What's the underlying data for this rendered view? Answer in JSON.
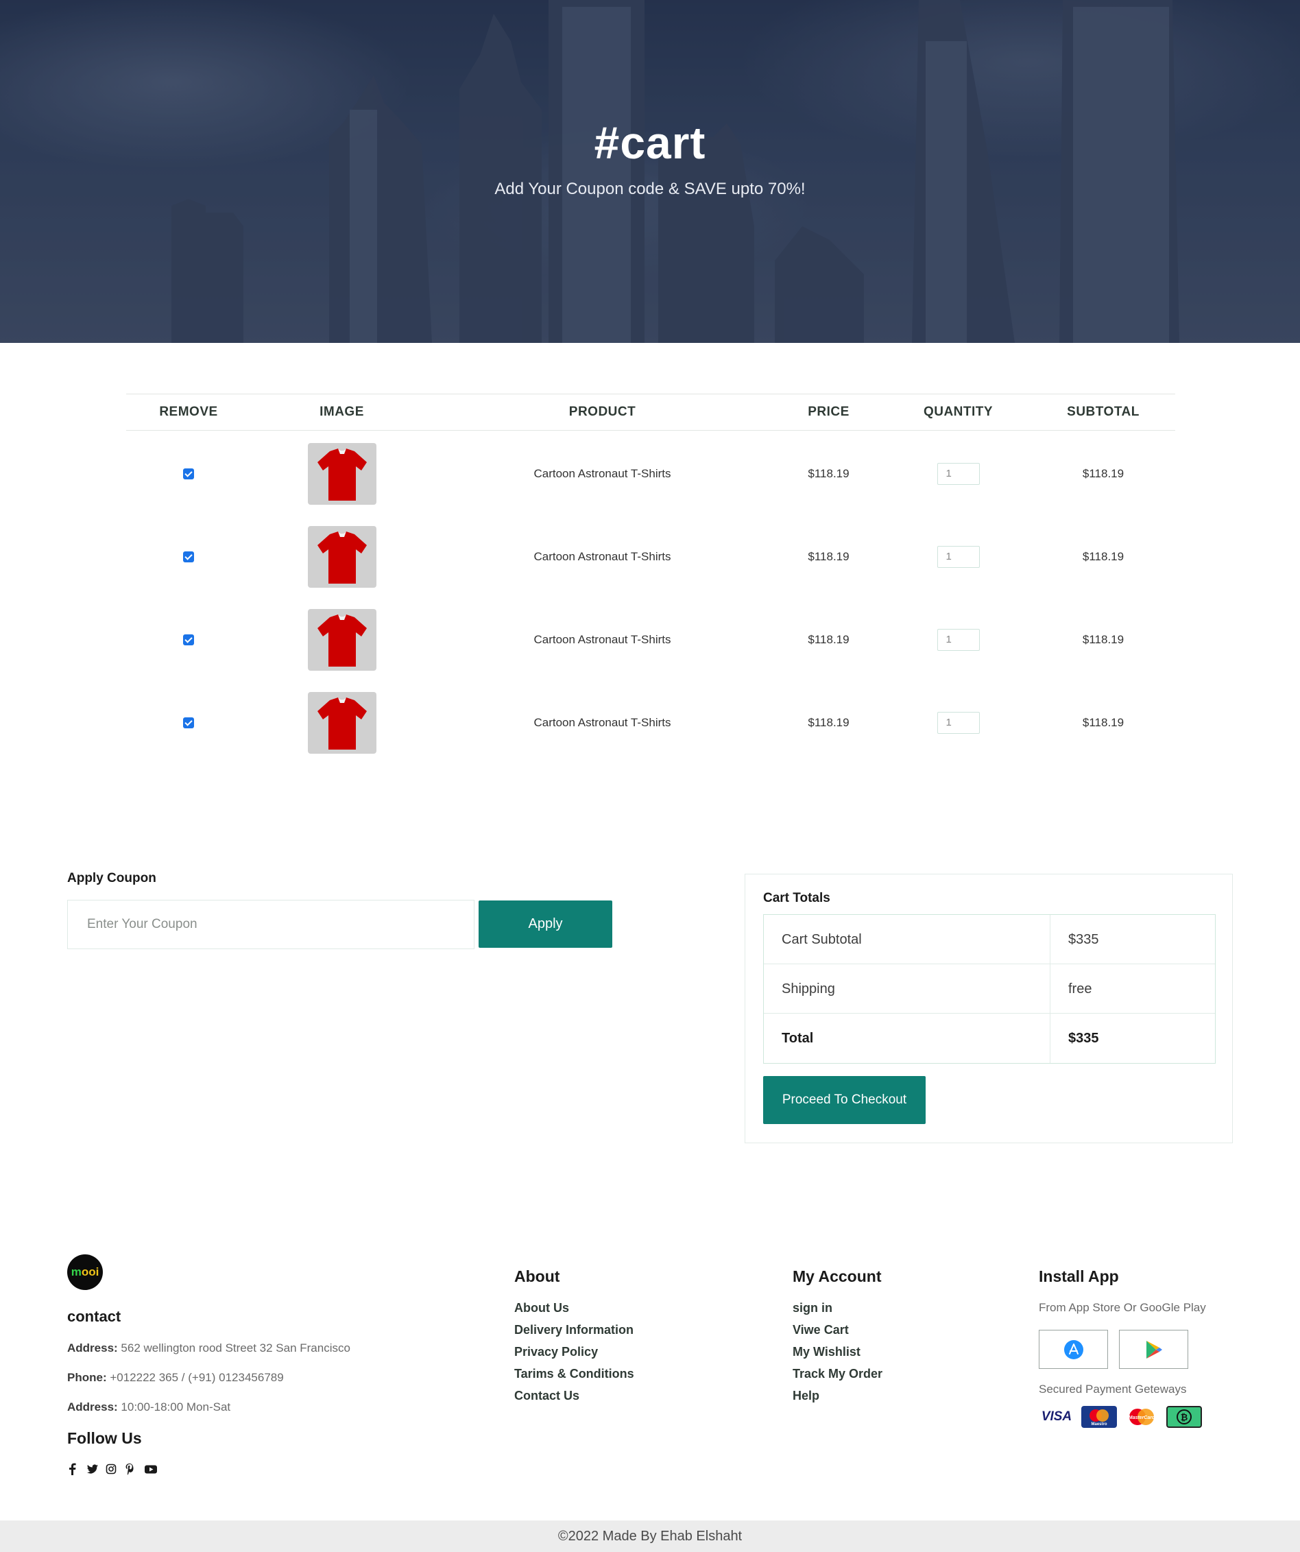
{
  "hero": {
    "title": "#cart",
    "subtitle": "Add Your Coupon code & SAVE upto 70%!"
  },
  "cart": {
    "headers": [
      "REMOVE",
      "IMAGE",
      "PRODUCT",
      "PRICE",
      "QUANTITY",
      "SUBTOTAL"
    ],
    "rows": [
      {
        "product": "Cartoon Astronaut T-Shirts",
        "price": "$118.19",
        "quantity": "1",
        "subtotal": "$118.19",
        "checked": true
      },
      {
        "product": "Cartoon Astronaut T-Shirts",
        "price": "$118.19",
        "quantity": "1",
        "subtotal": "$118.19",
        "checked": true
      },
      {
        "product": "Cartoon Astronaut T-Shirts",
        "price": "$118.19",
        "quantity": "1",
        "subtotal": "$118.19",
        "checked": true
      },
      {
        "product": "Cartoon Astronaut T-Shirts",
        "price": "$118.19",
        "quantity": "1",
        "subtotal": "$118.19",
        "checked": true
      }
    ]
  },
  "coupon": {
    "title": "Apply Coupon",
    "placeholder": "Enter Your Coupon",
    "button": "Apply"
  },
  "totals": {
    "title": "Cart Totals",
    "rows": [
      {
        "label": "Cart Subtotal",
        "value": "$335"
      },
      {
        "label": "Shipping",
        "value": "free"
      },
      {
        "label": "Total",
        "value": "$335"
      }
    ],
    "checkout": "Proceed To Checkout"
  },
  "footer": {
    "logo_a": "m",
    "logo_b": "ooi",
    "contact_heading": "contact",
    "address_label": "Address:",
    "address": "562 wellington rood Street 32 San Francisco",
    "phone_label": "Phone:",
    "phone": "+012222 365 / (+91) 0123456789",
    "hours_label": "Address:",
    "hours": "10:00-18:00 Mon-Sat",
    "follow_heading": "Follow Us",
    "social_icons": [
      "facebook-icon",
      "twitter-icon",
      "instagram-icon",
      "pinterest-icon",
      "youtube-icon"
    ],
    "about": {
      "heading": "About",
      "links": [
        "About Us",
        "Delivery Information",
        "Privacy Policy",
        "Tarims & Conditions",
        "Contact Us"
      ]
    },
    "account": {
      "heading": "My Account",
      "links": [
        "sign in",
        "Viwe Cart",
        "My Wishlist",
        "Track My Order",
        "Help"
      ]
    },
    "install": {
      "heading": "Install App",
      "sub": "From App Store Or GooGle Play",
      "secure": "Secured Payment Geteways",
      "payments": [
        "VISA",
        "Maestro",
        "MasterCard",
        "Bitcoin"
      ]
    },
    "copyright": "©2022 Made By Ehab Elshaht"
  },
  "colors": {
    "accent": "#0f7f74",
    "checkbox": "#1a73e8",
    "shirt": "#cc0000"
  }
}
